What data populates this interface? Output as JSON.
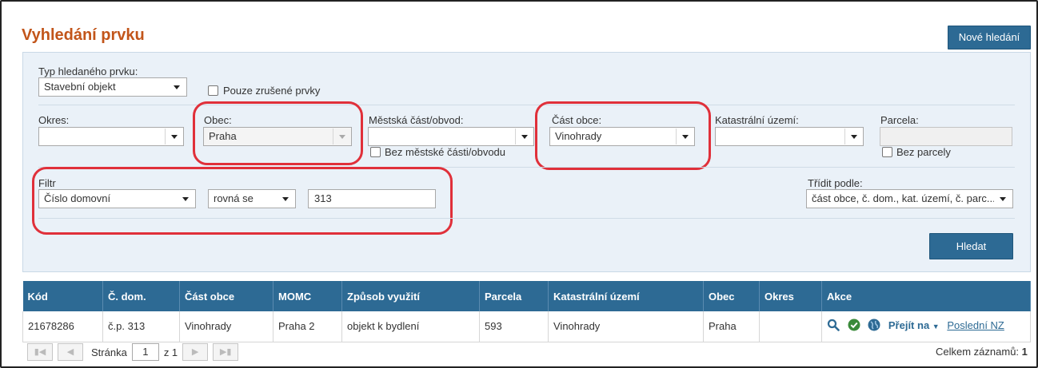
{
  "page": {
    "title": "Vyhledání prvku"
  },
  "header": {
    "new_search_label": "Nové hledání"
  },
  "form": {
    "type_label": "Typ hledaného prvku:",
    "type_value": "Stavební objekt",
    "only_cancelled_label": "Pouze zrušené prvky",
    "okres_label": "Okres:",
    "okres_value": "",
    "obec_label": "Obec:",
    "obec_value": "Praha",
    "mestska_cast_label": "Městská část/obvod:",
    "mestska_cast_value": "",
    "bez_mestske_casti_label": "Bez městské části/obvodu",
    "cast_obce_label": "Část obce:",
    "cast_obce_value": "Vinohrady",
    "katastralni_uzemi_label": "Katastrální území:",
    "katastralni_uzemi_value": "",
    "parcela_label": "Parcela:",
    "parcela_value": "",
    "bez_parcely_label": "Bez parcely",
    "filter_label": "Filtr",
    "filter_field_value": "Číslo domovní",
    "filter_op_value": "rovná se",
    "filter_input_value": "313",
    "sort_label": "Třídit podle:",
    "sort_value": "část obce, č. dom., kat. území, č. parc...",
    "search_button_label": "Hledat"
  },
  "table": {
    "columns": [
      "Kód",
      "Č. dom.",
      "Část obce",
      "MOMC",
      "Způsob využití",
      "Parcela",
      "Katastrální území",
      "Obec",
      "Okres",
      "Akce"
    ],
    "rows": [
      {
        "kod": "21678286",
        "cislo_domovni": "č.p. 313",
        "cast_obce": "Vinohrady",
        "momc": "Praha 2",
        "zpusob_vyuziti": "objekt k bydlení",
        "parcela": "593",
        "katastralni_uzemi": "Vinohrady",
        "obec": "Praha",
        "okres": "",
        "akce": {
          "goto_label": "Přejít na",
          "last_nz_label": "Poslední NZ"
        }
      }
    ]
  },
  "pager": {
    "page_label": "Stránka",
    "page_value": "1",
    "of_label": "z 1",
    "total_label": "Celkem záznamů:",
    "total_value": "1"
  },
  "colors": {
    "accent": "#2d6a94",
    "title": "#c2551a",
    "highlight": "#e0303a",
    "panel": "#eaf1f8"
  },
  "icons": [
    "search-icon",
    "check-circle-icon",
    "globe-icon",
    "chevron-down-icon",
    "first-page-icon",
    "prev-page-icon",
    "next-page-icon",
    "last-page-icon"
  ]
}
